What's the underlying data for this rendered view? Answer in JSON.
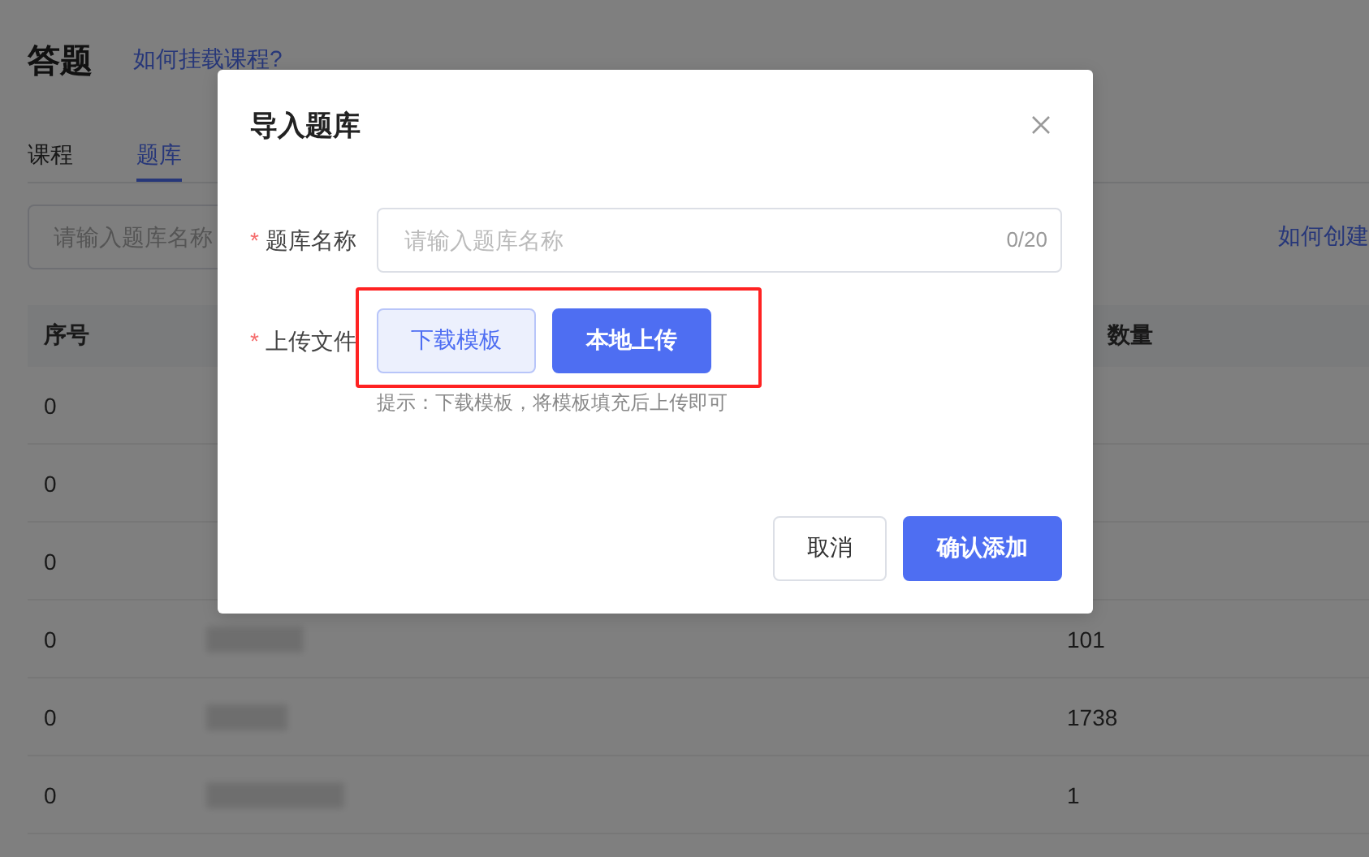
{
  "page": {
    "title": "答题",
    "help_link": "如何挂载课程?",
    "create_link": "如何创建"
  },
  "tabs": [
    {
      "label": "课程",
      "selected": false
    },
    {
      "label": "题库",
      "selected": true
    }
  ],
  "search": {
    "placeholder": "请输入题库名称"
  },
  "table": {
    "columns": [
      "序号",
      "数量"
    ],
    "rows": [
      {
        "index": "0"
      },
      {
        "index": "0"
      },
      {
        "index": "0"
      },
      {
        "index": "0",
        "redacted": true,
        "count": "101"
      },
      {
        "index": "0",
        "redacted": true,
        "count": "1738"
      },
      {
        "index": "0",
        "redacted": true,
        "count": "1"
      }
    ]
  },
  "dialog": {
    "title": "导入题库",
    "fields": [
      {
        "kind": "input",
        "label": "题库名称",
        "required_mark": "*",
        "placeholder": "请输入题库名称",
        "counter": "0/20"
      },
      {
        "kind": "upload",
        "label": "上传文件",
        "required_mark": "*",
        "highlighted": true,
        "buttons": [
          {
            "label": "下载模板",
            "kind": "secondary"
          },
          {
            "label": "本地上传",
            "kind": "primary"
          }
        ],
        "hint": "提示：下载模板，将模板填充后上传即可"
      }
    ],
    "buttons": [
      {
        "label": "取消",
        "kind": "default"
      },
      {
        "label": "确认添加",
        "kind": "primary"
      }
    ]
  }
}
